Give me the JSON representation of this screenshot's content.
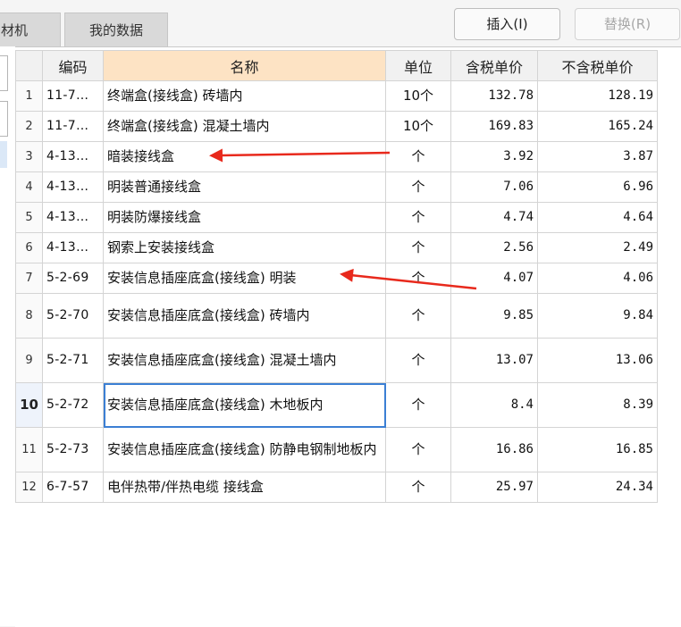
{
  "tabs": [
    {
      "label": "材机"
    },
    {
      "label": "我的数据"
    }
  ],
  "buttons": {
    "insert_label": "插入(I)",
    "replace_label": "替换(R)"
  },
  "grid": {
    "columns": [
      "编码",
      "名称",
      "单位",
      "含税单价",
      "不含税单价"
    ],
    "selected_row": 10,
    "rows": [
      {
        "idx": "1",
        "code": "11-7…",
        "name": "终端盒(接线盒) 砖墙内",
        "unit": "10个",
        "tax_price": "132.78",
        "notax_price": "128.19"
      },
      {
        "idx": "2",
        "code": "11-7…",
        "name": "终端盒(接线盒) 混凝土墙内",
        "unit": "10个",
        "tax_price": "169.83",
        "notax_price": "165.24"
      },
      {
        "idx": "3",
        "code": "4-13…",
        "name": "暗装接线盒",
        "unit": "个",
        "tax_price": "3.92",
        "notax_price": "3.87"
      },
      {
        "idx": "4",
        "code": "4-13…",
        "name": "明装普通接线盒",
        "unit": "个",
        "tax_price": "7.06",
        "notax_price": "6.96"
      },
      {
        "idx": "5",
        "code": "4-13…",
        "name": "明装防爆接线盒",
        "unit": "个",
        "tax_price": "4.74",
        "notax_price": "4.64"
      },
      {
        "idx": "6",
        "code": "4-13…",
        "name": "钢索上安装接线盒",
        "unit": "个",
        "tax_price": "2.56",
        "notax_price": "2.49"
      },
      {
        "idx": "7",
        "code": "5-2-69",
        "name": "安装信息插座底盒(接线盒) 明装",
        "unit": "个",
        "tax_price": "4.07",
        "notax_price": "4.06"
      },
      {
        "idx": "8",
        "code": "5-2-70",
        "name": "安装信息插座底盒(接线盒) 砖墙内",
        "unit": "个",
        "tax_price": "9.85",
        "notax_price": "9.84"
      },
      {
        "idx": "9",
        "code": "5-2-71",
        "name": "安装信息插座底盒(接线盒) 混凝土墙内",
        "unit": "个",
        "tax_price": "13.07",
        "notax_price": "13.06"
      },
      {
        "idx": "10",
        "code": "5-2-72",
        "name": "安装信息插座底盒(接线盒) 木地板内",
        "unit": "个",
        "tax_price": "8.4",
        "notax_price": "8.39"
      },
      {
        "idx": "11",
        "code": "5-2-73",
        "name": "安装信息插座底盒(接线盒) 防静电钢制地板内",
        "unit": "个",
        "tax_price": "16.86",
        "notax_price": "16.85"
      },
      {
        "idx": "12",
        "code": "6-7-57",
        "name": "电伴热带/伴热电缆 接线盒",
        "unit": "个",
        "tax_price": "25.97",
        "notax_price": "24.34"
      }
    ]
  },
  "annotation_color": "#e8291c"
}
